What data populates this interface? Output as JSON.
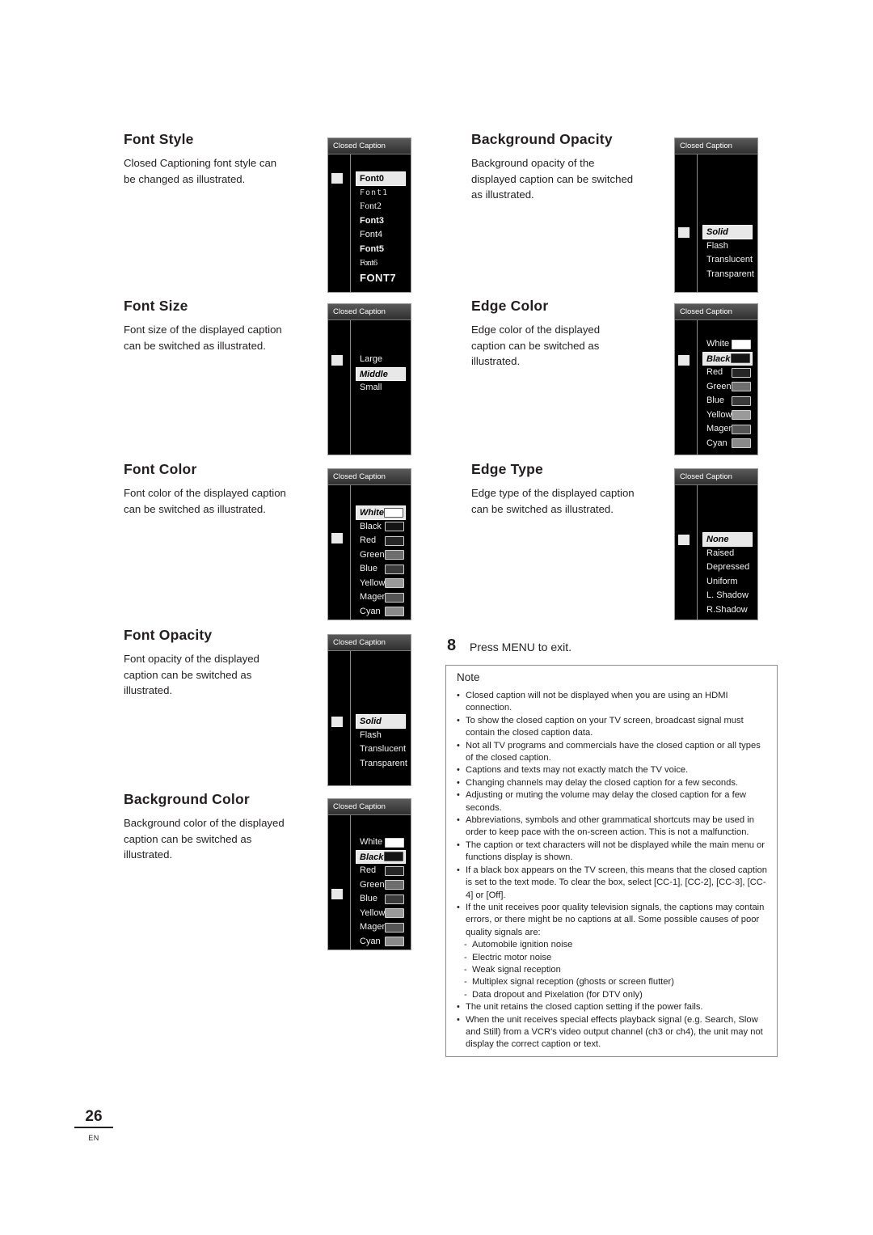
{
  "page": {
    "number": "26",
    "region": "EN"
  },
  "sections": [
    {
      "title": "Font Style",
      "body": "Closed Captioning font style can be changed as illustrated."
    },
    {
      "title": "Font Size",
      "body": "Font size of the displayed caption can be switched as illustrated."
    },
    {
      "title": "Font Color",
      "body": "Font color of the displayed caption can be switched as illustrated."
    },
    {
      "title": "Font Opacity",
      "body": "Font opacity of the displayed caption can be switched as illustrated."
    },
    {
      "title": "Background Color",
      "body": "Background color of the displayed caption can be switched as illustrated."
    },
    {
      "title": "Background Opacity",
      "body": "Background opacity of the displayed caption can be switched as illustrated."
    },
    {
      "title": "Edge Color",
      "body": "Edge color of the displayed caption can be switched as illustrated."
    },
    {
      "title": "Edge Type",
      "body": "Edge type of the displayed caption can be switched as illustrated."
    }
  ],
  "osd_title": "Closed Caption",
  "osd": {
    "font_style": {
      "items": [
        "Font0",
        "Font1",
        "Font2",
        "Font3",
        "Font4",
        "Font5",
        "Font6",
        "FONT7"
      ],
      "selected": 0
    },
    "font_size": {
      "items": [
        "Large",
        "Middle",
        "Small"
      ],
      "selected": 1
    },
    "font_color": {
      "items": [
        "White",
        "Black",
        "Red",
        "Green",
        "Blue",
        "Yellow",
        "Magenta",
        "Cyan"
      ],
      "selected": 0
    },
    "font_opacity": {
      "items": [
        "Solid",
        "Flash",
        "Translucent",
        "Transparent"
      ],
      "selected": 0
    },
    "background_color": {
      "items": [
        "White",
        "Black",
        "Red",
        "Green",
        "Blue",
        "Yellow",
        "Magenta",
        "Cyan"
      ],
      "selected": 1
    },
    "background_opacity": {
      "items": [
        "Solid",
        "Flash",
        "Translucent",
        "Transparent"
      ],
      "selected": 0
    },
    "edge_color": {
      "items": [
        "White",
        "Black",
        "Red",
        "Green",
        "Blue",
        "Yellow",
        "Magenta",
        "Cyan"
      ],
      "selected": 1
    },
    "edge_type": {
      "items": [
        "None",
        "Raised",
        "Depressed",
        "Uniform",
        "L. Shadow",
        "R.Shadow"
      ],
      "selected": 0
    }
  },
  "step": {
    "number": "8",
    "text": "Press MENU to exit."
  },
  "note": {
    "title": "Note",
    "items": [
      {
        "type": "bullet",
        "text": "Closed caption will not be displayed when you are using an HDMI connection."
      },
      {
        "type": "bullet",
        "text": "To show the closed caption on your TV screen, broadcast signal must contain the closed caption data."
      },
      {
        "type": "bullet",
        "text": "Not all TV programs and commercials have the closed caption or all types of the closed caption."
      },
      {
        "type": "bullet",
        "text": "Captions and texts may not exactly match the TV voice."
      },
      {
        "type": "bullet",
        "text": "Changing channels may delay the closed caption for a few seconds."
      },
      {
        "type": "bullet",
        "text": "Adjusting or muting the volume may delay the closed caption for a few seconds."
      },
      {
        "type": "bullet",
        "text": "Abbreviations, symbols and other grammatical shortcuts may be used in order to keep pace with the on-screen action. This is not a malfunction."
      },
      {
        "type": "bullet",
        "text": "The caption or text characters will not be displayed while the main menu or functions display is shown."
      },
      {
        "type": "bullet",
        "text": "If a black box appears on the TV screen, this means that the closed caption is set to the text mode. To clear the box, select [CC-1], [CC-2], [CC-3], [CC-4] or [Off]."
      },
      {
        "type": "bullet",
        "text": "If the unit receives poor quality television signals, the captions may contain errors, or there might be no captions at all. Some possible causes of poor quality signals are:"
      },
      {
        "type": "dash",
        "text": "Automobile ignition noise"
      },
      {
        "type": "dash",
        "text": "Electric motor noise"
      },
      {
        "type": "dash",
        "text": "Weak signal reception"
      },
      {
        "type": "dash",
        "text": "Multiplex signal reception (ghosts or screen flutter)"
      },
      {
        "type": "dash",
        "text": "Data dropout and Pixelation (for DTV only)"
      },
      {
        "type": "bullet",
        "text": "The unit retains the closed caption setting if the power fails."
      },
      {
        "type": "bullet",
        "text": "When the unit receives special effects playback signal (e.g. Search, Slow and Still) from a VCR's video output channel (ch3 or ch4), the unit may not display the correct caption or text."
      }
    ]
  }
}
